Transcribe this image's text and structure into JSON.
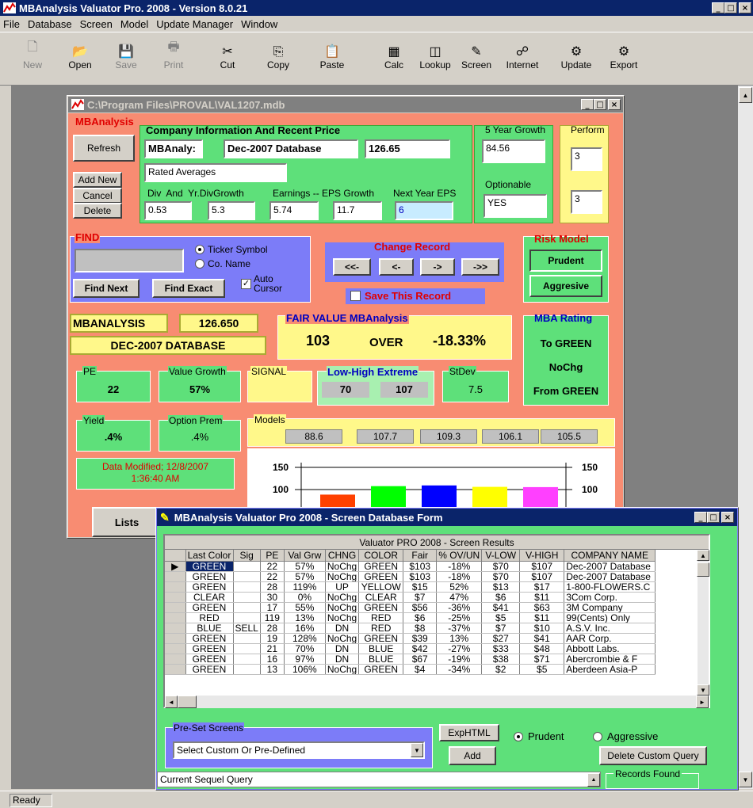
{
  "app": {
    "title": "MBAnalysis Valuator Pro. 2008 - Version 8.0.21"
  },
  "menu": [
    "File",
    "Database",
    "Screen",
    "Model",
    "Update Manager",
    "Window"
  ],
  "toolbar": [
    {
      "label": "New",
      "icon": "new-document-icon",
      "enabled": false
    },
    {
      "label": "Open",
      "icon": "open-folder-icon",
      "enabled": true
    },
    {
      "label": "Save",
      "icon": "floppy-disk-icon",
      "enabled": false
    },
    {
      "label": "Print",
      "icon": "printer-icon",
      "enabled": false
    },
    {
      "label": "Cut",
      "icon": "scissors-icon",
      "enabled": true
    },
    {
      "label": "Copy",
      "icon": "copy-icon",
      "enabled": true
    },
    {
      "label": "Paste",
      "icon": "clipboard-icon",
      "enabled": true
    },
    {
      "label": "Calc",
      "icon": "calculator-icon",
      "enabled": true
    },
    {
      "label": "Lookup",
      "icon": "lookup-icon",
      "enabled": true
    },
    {
      "label": "Screen",
      "icon": "pencil-icon",
      "enabled": true
    },
    {
      "label": "Internet",
      "icon": "network-icon",
      "enabled": true
    },
    {
      "label": "Update",
      "icon": "update-icon",
      "enabled": true
    },
    {
      "label": "Export",
      "icon": "export-icon",
      "enabled": true
    }
  ],
  "mdi": {
    "title": "C:\\Program Files\\PROVAL\\VAL1207.mdb",
    "mba_group": "MBAnalysis",
    "refresh": "Refresh",
    "add_new": "Add New",
    "cancel": "Cancel",
    "delete": "Delete",
    "company_group": "Company Information And Recent Price",
    "ticker": "MBAnaly:",
    "db_name": "Dec-2007 Database",
    "price": "126.65",
    "rated": "Rated Averages",
    "growth5_label": "5 Year Growth",
    "growth5": "84.56",
    "perform_label": "Perform",
    "perform1": "3",
    "perform2": "3",
    "optionable_label": "Optionable",
    "optionable": "YES",
    "div_label": "Div  And  Yr.DivGrowth",
    "div": "0.53",
    "divgrowth": "5.3",
    "earn_label": "Earnings -- EPS Growth",
    "earnings": "5.74",
    "epsgrowth": "11.7",
    "nexteps_label": "Next Year EPS",
    "nexteps": "6",
    "find_label": "FIND",
    "ticker_symbol": "Ticker Symbol",
    "co_name": "Co. Name",
    "find_next": "Find Next",
    "find_exact": "Find Exact",
    "auto_cursor": "Auto\nCursor",
    "change_label": "Change Record",
    "nav": [
      "<<-",
      "<-",
      "->",
      "->>"
    ],
    "save_record": "Save This Record",
    "risk_label": "Risk Model",
    "prudent": "Prudent",
    "aggresive": "Aggresive",
    "ticker_display": "MBANALYSIS",
    "price_display": "126.650",
    "db_display": "DEC-2007 DATABASE",
    "fair_label": "FAIR VALUE MBAnalysis",
    "fair": "103",
    "over": "OVER",
    "pct": "-18.33%",
    "rating_label": "MBA Rating",
    "rating": [
      "To GREEN",
      "NoChg",
      "From GREEN"
    ],
    "pe_label": "PE",
    "pe": "22",
    "vg_label": "Value Growth",
    "vg": "57%",
    "signal_label": "SIGNAL",
    "lh_label": "Low-High Extreme",
    "low": "70",
    "high": "107",
    "stdev_label": "StDev",
    "stdev": "7.5",
    "yield_label": "Yield",
    "yield": ".4%",
    "optprem_label": "Option Prem",
    "optprem": ".4%",
    "models_label": "Models",
    "models": [
      "88.6",
      "107.7",
      "109.3",
      "106.1",
      "105.5"
    ],
    "data_modified": "Data Modified; 12/8/2007\n1:36:40 AM",
    "lists": "Lists"
  },
  "chart_data": {
    "type": "bar",
    "categories": [
      "88.6",
      "107.7",
      "109.3",
      "106.1",
      "105.5"
    ],
    "values": [
      88.6,
      107.7,
      109.3,
      106.1,
      105.5
    ],
    "colors": [
      "#ff4000",
      "#00ff00",
      "#0000ff",
      "#ffff00",
      "#ff40ff"
    ],
    "yticks": [
      "150",
      "100"
    ]
  },
  "screen": {
    "title": "MBAnalysis Valuator Pro 2008 - Screen Database Form",
    "caption": "Valuator PRO 2008 - Screen Results",
    "columns": [
      "Last Color",
      "Sig",
      "PE",
      "Val Grw",
      "CHNG",
      "COLOR",
      "Fair",
      "% OV/UN",
      "V-LOW",
      "V-HIGH",
      "COMPANY NAME"
    ],
    "rows": [
      [
        "GREEN",
        "",
        "22",
        "57%",
        "NoChg",
        "GREEN",
        "$103",
        "-18%",
        "$70",
        "$107",
        "Dec-2007 Database"
      ],
      [
        "GREEN",
        "",
        "22",
        "57%",
        "NoChg",
        "GREEN",
        "$103",
        "-18%",
        "$70",
        "$107",
        "Dec-2007 Database"
      ],
      [
        "GREEN",
        "",
        "28",
        "119%",
        "UP",
        "YELLOW",
        "$15",
        "52%",
        "$13",
        "$17",
        "1-800-FLOWERS.C"
      ],
      [
        "CLEAR",
        "",
        "30",
        "0%",
        "NoChg",
        "CLEAR",
        "$7",
        "47%",
        "$6",
        "$11",
        "3Com Corp."
      ],
      [
        "GREEN",
        "",
        "17",
        "55%",
        "NoChg",
        "GREEN",
        "$56",
        "-36%",
        "$41",
        "$63",
        "3M Company"
      ],
      [
        "RED",
        "",
        "119",
        "13%",
        "NoChg",
        "RED",
        "$6",
        "-25%",
        "$5",
        "$11",
        "99(Cents) Only"
      ],
      [
        "BLUE",
        "SELL",
        "28",
        "16%",
        "DN",
        "RED",
        "$8",
        "-37%",
        "$7",
        "$10",
        "A.S.V. Inc."
      ],
      [
        "GREEN",
        "",
        "19",
        "128%",
        "NoChg",
        "GREEN",
        "$39",
        "13%",
        "$27",
        "$41",
        "AAR Corp."
      ],
      [
        "GREEN",
        "",
        "21",
        "70%",
        "DN",
        "BLUE",
        "$42",
        "-27%",
        "$33",
        "$48",
        "Abbott Labs."
      ],
      [
        "GREEN",
        "",
        "16",
        "97%",
        "DN",
        "BLUE",
        "$67",
        "-19%",
        "$38",
        "$71",
        "Abercrombie & F"
      ],
      [
        "GREEN",
        "",
        "13",
        "106%",
        "NoChg",
        "GREEN",
        "$4",
        "-34%",
        "$2",
        "$5",
        "Aberdeen Asia-P"
      ]
    ],
    "preset_label": "Pre-Set Screens",
    "preset_value": "Select Custom Or Pre-Defined",
    "exphtml": "ExpHTML",
    "add": "Add",
    "prudent": "Prudent",
    "aggressive": "Aggressive",
    "delete_query": "Delete Custom Query",
    "sequel": "Current Sequel Query",
    "records_found": "Records Found"
  },
  "status": "Ready"
}
